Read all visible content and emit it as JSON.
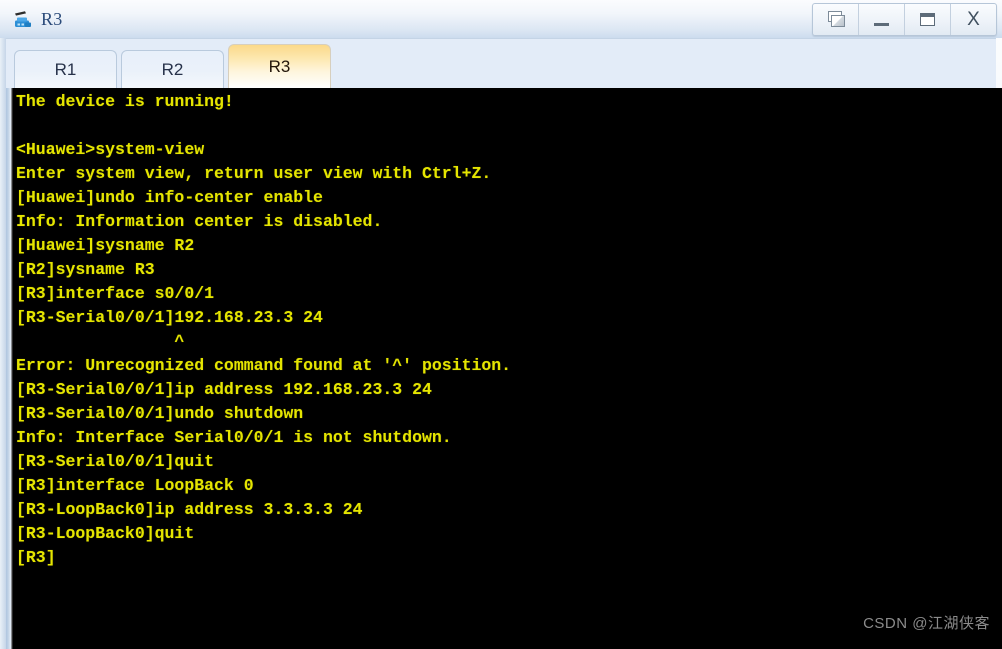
{
  "window": {
    "title": "R3",
    "icon": "router-device-icon",
    "controls": [
      {
        "name": "cascade-windows-button",
        "icon": "cascade-windows-icon",
        "label": ""
      },
      {
        "name": "minimize-button",
        "icon": "minimize-icon",
        "label": ""
      },
      {
        "name": "maximize-button",
        "icon": "maximize-icon",
        "label": ""
      },
      {
        "name": "close-button",
        "icon": "close-icon",
        "label": "X"
      }
    ]
  },
  "tabs": {
    "items": [
      {
        "label": "R1",
        "active": false
      },
      {
        "label": "R2",
        "active": false
      },
      {
        "label": "R3",
        "active": true
      }
    ],
    "active_label": "R3"
  },
  "terminal": {
    "foreground_color": "#e5e500",
    "background_color": "#000000",
    "text": "The device is running!\n\n<Huawei>system-view\nEnter system view, return user view with Ctrl+Z.\n[Huawei]undo info-center enable\nInfo: Information center is disabled.\n[Huawei]sysname R2\n[R2]sysname R3\n[R3]interface s0/0/1\n[R3-Serial0/0/1]192.168.23.3 24\n                ^\nError: Unrecognized command found at '^' position.\n[R3-Serial0/0/1]ip address 192.168.23.3 24\n[R3-Serial0/0/1]undo shutdown\nInfo: Interface Serial0/0/1 is not shutdown.\n[R3-Serial0/0/1]quit\n[R3]interface LoopBack 0\n[R3-LoopBack0]ip address 3.3.3.3 24\n[R3-LoopBack0]quit\n[R3]",
    "lines": [
      "The device is running!",
      "",
      "<Huawei>system-view",
      "Enter system view, return user view with Ctrl+Z.",
      "[Huawei]undo info-center enable",
      "Info: Information center is disabled.",
      "[Huawei]sysname R2",
      "[R2]sysname R3",
      "[R3]interface s0/0/1",
      "[R3-Serial0/0/1]192.168.23.3 24",
      "                ^",
      "Error: Unrecognized command found at '^' position.",
      "[R3-Serial0/0/1]ip address 192.168.23.3 24",
      "[R3-Serial0/0/1]undo shutdown",
      "Info: Interface Serial0/0/1 is not shutdown.",
      "[R3-Serial0/0/1]quit",
      "[R3]interface LoopBack 0",
      "[R3-LoopBack0]ip address 3.3.3.3 24",
      "[R3-LoopBack0]quit",
      "[R3]"
    ]
  },
  "watermark": {
    "text": "CSDN @江湖侠客",
    "color": "#8b8b8b"
  }
}
